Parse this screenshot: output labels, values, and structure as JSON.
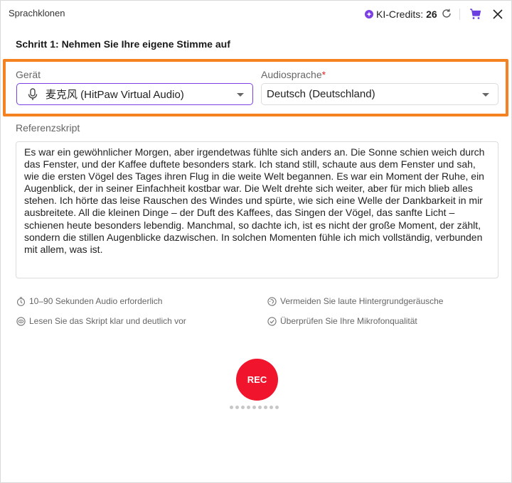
{
  "window": {
    "title": "Sprachklonen",
    "credits_label": "KI-Credits:",
    "credits_value": "26"
  },
  "step": {
    "title": "Schritt 1: Nehmen Sie Ihre eigene Stimme auf"
  },
  "device": {
    "label": "Gerät",
    "selected": "麦克风 (HitPaw Virtual Audio)"
  },
  "language": {
    "label": "Audiosprache",
    "required_mark": "*",
    "selected": "Deutsch (Deutschland)"
  },
  "script": {
    "label": "Referenzskript",
    "text": "Es war ein gewöhnlicher Morgen, aber irgendetwas fühlte sich anders an. Die Sonne schien weich durch das Fenster, und der Kaffee duftete besonders stark. Ich stand still, schaute aus dem Fenster und sah, wie die ersten Vögel des Tages ihren Flug in die weite Welt begannen. Es war ein Moment der Ruhe, ein Augenblick, der in seiner Einfachheit kostbar war. Die Welt drehte sich weiter, aber für mich blieb alles stehen. Ich hörte das leise Rauschen des Windes und spürte, wie sich eine Welle der Dankbarkeit in mir ausbreitete. All die kleinen Dinge – der Duft des Kaffees, das Singen der Vögel, das sanfte Licht – schienen heute besonders lebendig. Manchmal, so dachte ich, ist es nicht der große Moment, der zählt, sondern die stillen Augenblicke dazwischen. In solchen Momenten fühle ich mich vollständig, verbunden mit allem, was ist."
  },
  "hints": [
    {
      "icon": "timer-icon",
      "text": "10–90 Sekunden Audio erforderlich"
    },
    {
      "icon": "noise-icon",
      "text": "Vermeiden Sie laute Hintergrundgeräusche"
    },
    {
      "icon": "eye-icon",
      "text": "Lesen Sie das Skript klar und deutlich vor"
    },
    {
      "icon": "check-circle-icon",
      "text": "Überprüfen Sie Ihre Mikrofonqualität"
    }
  ],
  "record": {
    "label": "REC"
  },
  "colors": {
    "accent": "#7b3fe4",
    "highlight": "#f58220",
    "record": "#f0142d"
  }
}
